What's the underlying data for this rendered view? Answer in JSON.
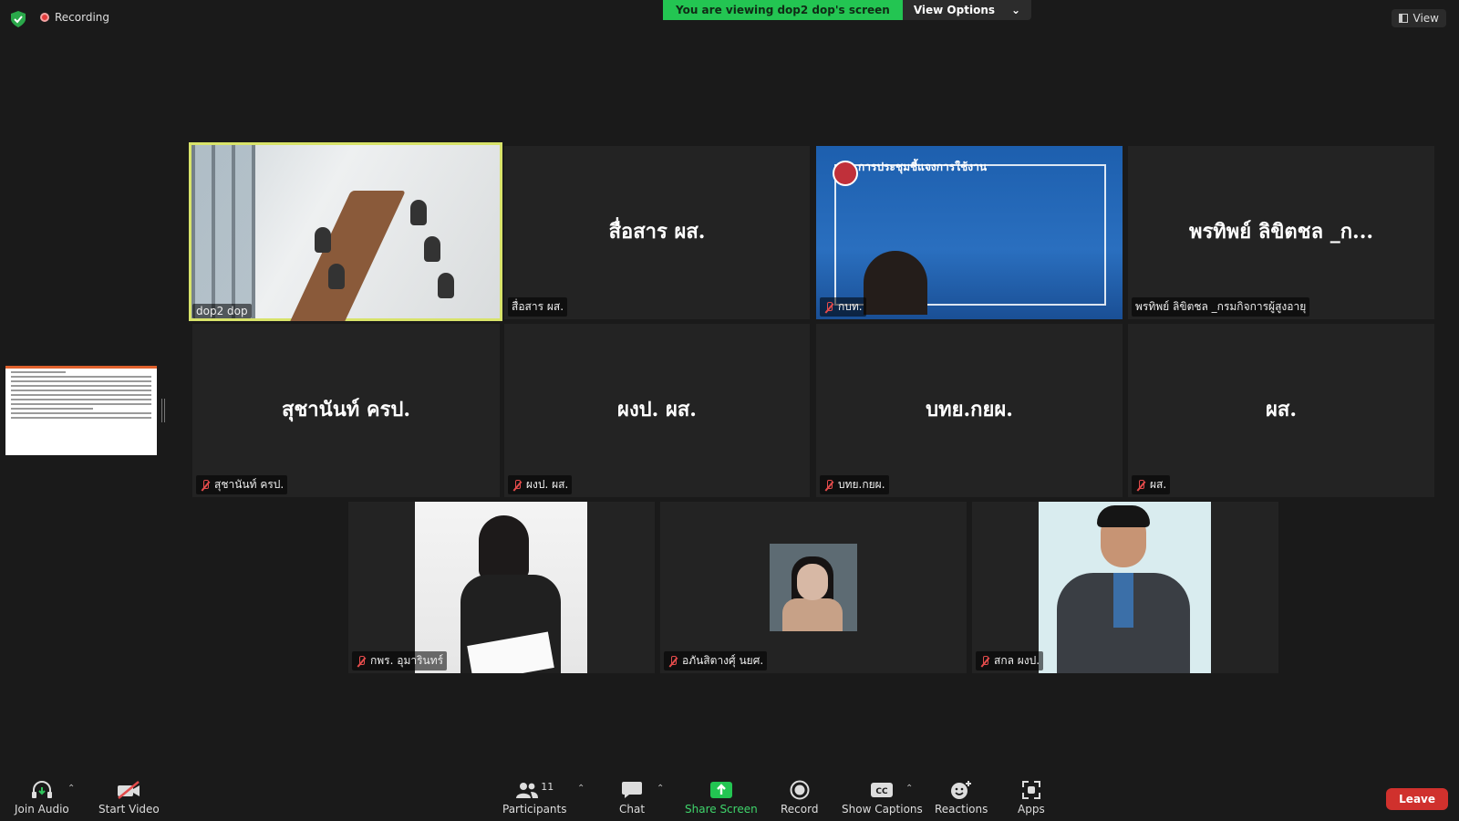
{
  "top": {
    "recording_label": "Recording",
    "banner_viewing": "You are viewing dop2 dop's screen",
    "view_options_label": "View Options",
    "view_label": "View"
  },
  "tiles": [
    {
      "name": "dop2 dop",
      "big": "",
      "muted": false
    },
    {
      "name": "สื่อสาร ผส.",
      "big": "สื่อสาร ผส.",
      "muted": false
    },
    {
      "name": "กบท.",
      "big": "",
      "muted": true
    },
    {
      "name": "พรทิพย์ ลิขิตชล _กรมกิจการผู้สูงอายุ",
      "big": "พรทิพย์ ลิขิตชล _ก...",
      "muted": false
    },
    {
      "name": "สุชานันท์ ครป.",
      "big": "สุชานันท์ ครป.",
      "muted": true
    },
    {
      "name": "ผงป. ผส.",
      "big": "ผงป. ผส.",
      "muted": true
    },
    {
      "name": "บทย.กยผ.",
      "big": "บทย.กยผ.",
      "muted": true
    },
    {
      "name": "ผส.",
      "big": "ผส.",
      "muted": true
    },
    {
      "name": "กพร. อุมารินทร์",
      "big": "",
      "muted": true
    },
    {
      "name": "อภันสิตางศุ์ นยศ.",
      "big": "",
      "muted": true
    },
    {
      "name": "สกล ผงป.",
      "big": "",
      "muted": true
    }
  ],
  "slide": {
    "title": "การประชุมชี้แจงการใช้งาน"
  },
  "toolbar": {
    "join_audio": "Join Audio",
    "start_video": "Start Video",
    "participants": "Participants",
    "participants_count": "11",
    "chat": "Chat",
    "share_screen": "Share Screen",
    "record": "Record",
    "show_captions": "Show Captions",
    "reactions": "Reactions",
    "apps": "Apps",
    "leave": "Leave"
  },
  "colors": {
    "accent_green": "#23c552",
    "active_speaker": "#d8e36a",
    "leave_red": "#d0312d",
    "mute_red": "#e34b4b"
  },
  "icons": [
    "shield-icon",
    "recording-icon",
    "chevron-down-icon",
    "view-icon",
    "headphones-icon",
    "video-off-icon",
    "participants-icon",
    "chat-icon",
    "share-screen-icon",
    "record-icon",
    "captions-icon",
    "reactions-icon",
    "apps-icon",
    "mic-muted-icon"
  ]
}
